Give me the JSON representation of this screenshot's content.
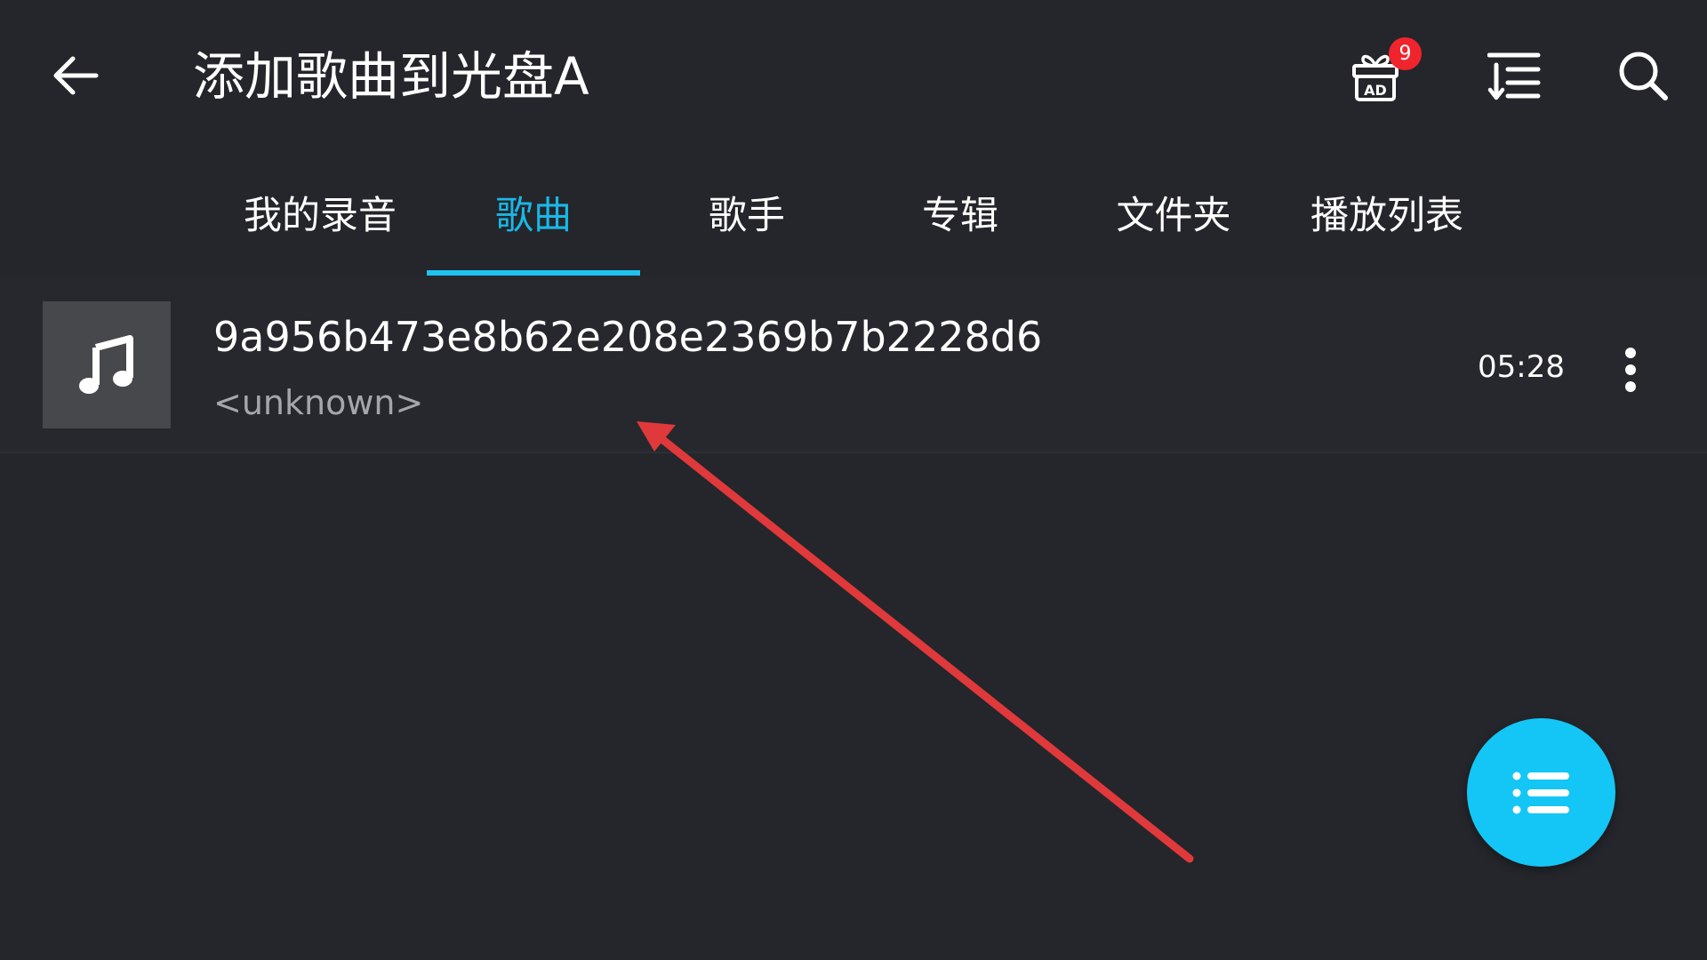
{
  "header": {
    "title": "添加歌曲到光盘A",
    "back_icon": "arrow-left-icon",
    "gift_icon": "gift-ad-icon",
    "gift_icon_text": "AD",
    "gift_badge_count": "9",
    "sort_icon": "sort-list-icon",
    "search_icon": "search-icon"
  },
  "tabs": [
    {
      "label": "我的录音",
      "active": false
    },
    {
      "label": "歌曲",
      "active": true
    },
    {
      "label": "歌手",
      "active": false
    },
    {
      "label": "专辑",
      "active": false
    },
    {
      "label": "文件夹",
      "active": false
    },
    {
      "label": "播放列表",
      "active": false
    }
  ],
  "songs": [
    {
      "title": "9a956b473e8b62e208e2369b7b2228d6",
      "artist": "<unknown>",
      "duration": "05:28",
      "thumbnail_icon": "music-note-icon",
      "menu_icon": "more-vertical-icon"
    }
  ],
  "fab": {
    "icon": "list-menu-icon"
  },
  "colors": {
    "background": "#24262b",
    "accent": "#1ab7e6",
    "fab": "#14c6f5",
    "badge": "#f0242d",
    "annotation_arrow": "#e0393b",
    "secondary_text": "#a5a6a9"
  }
}
